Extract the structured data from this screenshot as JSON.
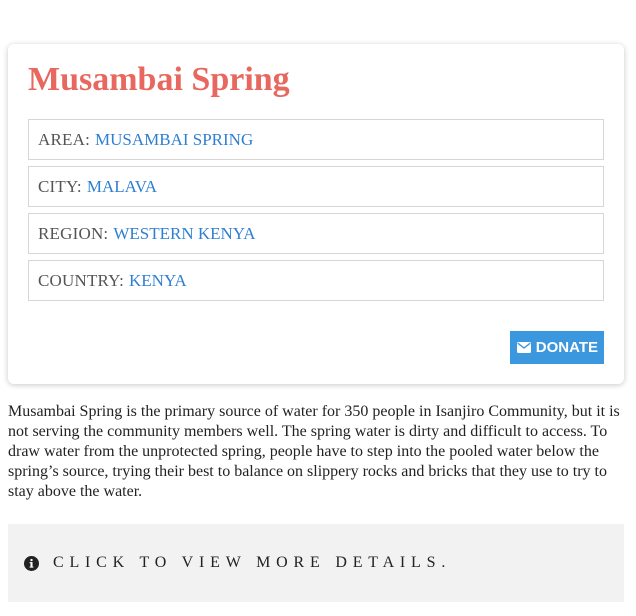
{
  "card": {
    "title": "Musambai Spring",
    "rows": [
      {
        "label": "AREA:",
        "value": "MUSAMBAI SPRING"
      },
      {
        "label": "CITY:",
        "value": "MALAVA"
      },
      {
        "label": "REGION:",
        "value": "WESTERN KENYA"
      },
      {
        "label": "COUNTRY:",
        "value": "KENYA"
      }
    ],
    "donate_label": "DONATE",
    "donate_icon": "envelope-icon"
  },
  "description": "Musambai Spring is the primary source of water for 350 people in Isanjiro Community, but it is not serving the community members well. The spring water is dirty and difficult to access. To draw water from the unprotected spring, people have to step into the pooled water below the spring’s source, trying their best to balance on slippery rocks and bricks that they use to try to stay above the water.",
  "details": {
    "label": "CLICK TO VIEW MORE DETAILS.",
    "icon": "info-circle-icon"
  },
  "colors": {
    "title": "#e8685f",
    "link": "#2f7fd1",
    "button": "#3b97de",
    "details_bg": "#f2f2f2"
  }
}
